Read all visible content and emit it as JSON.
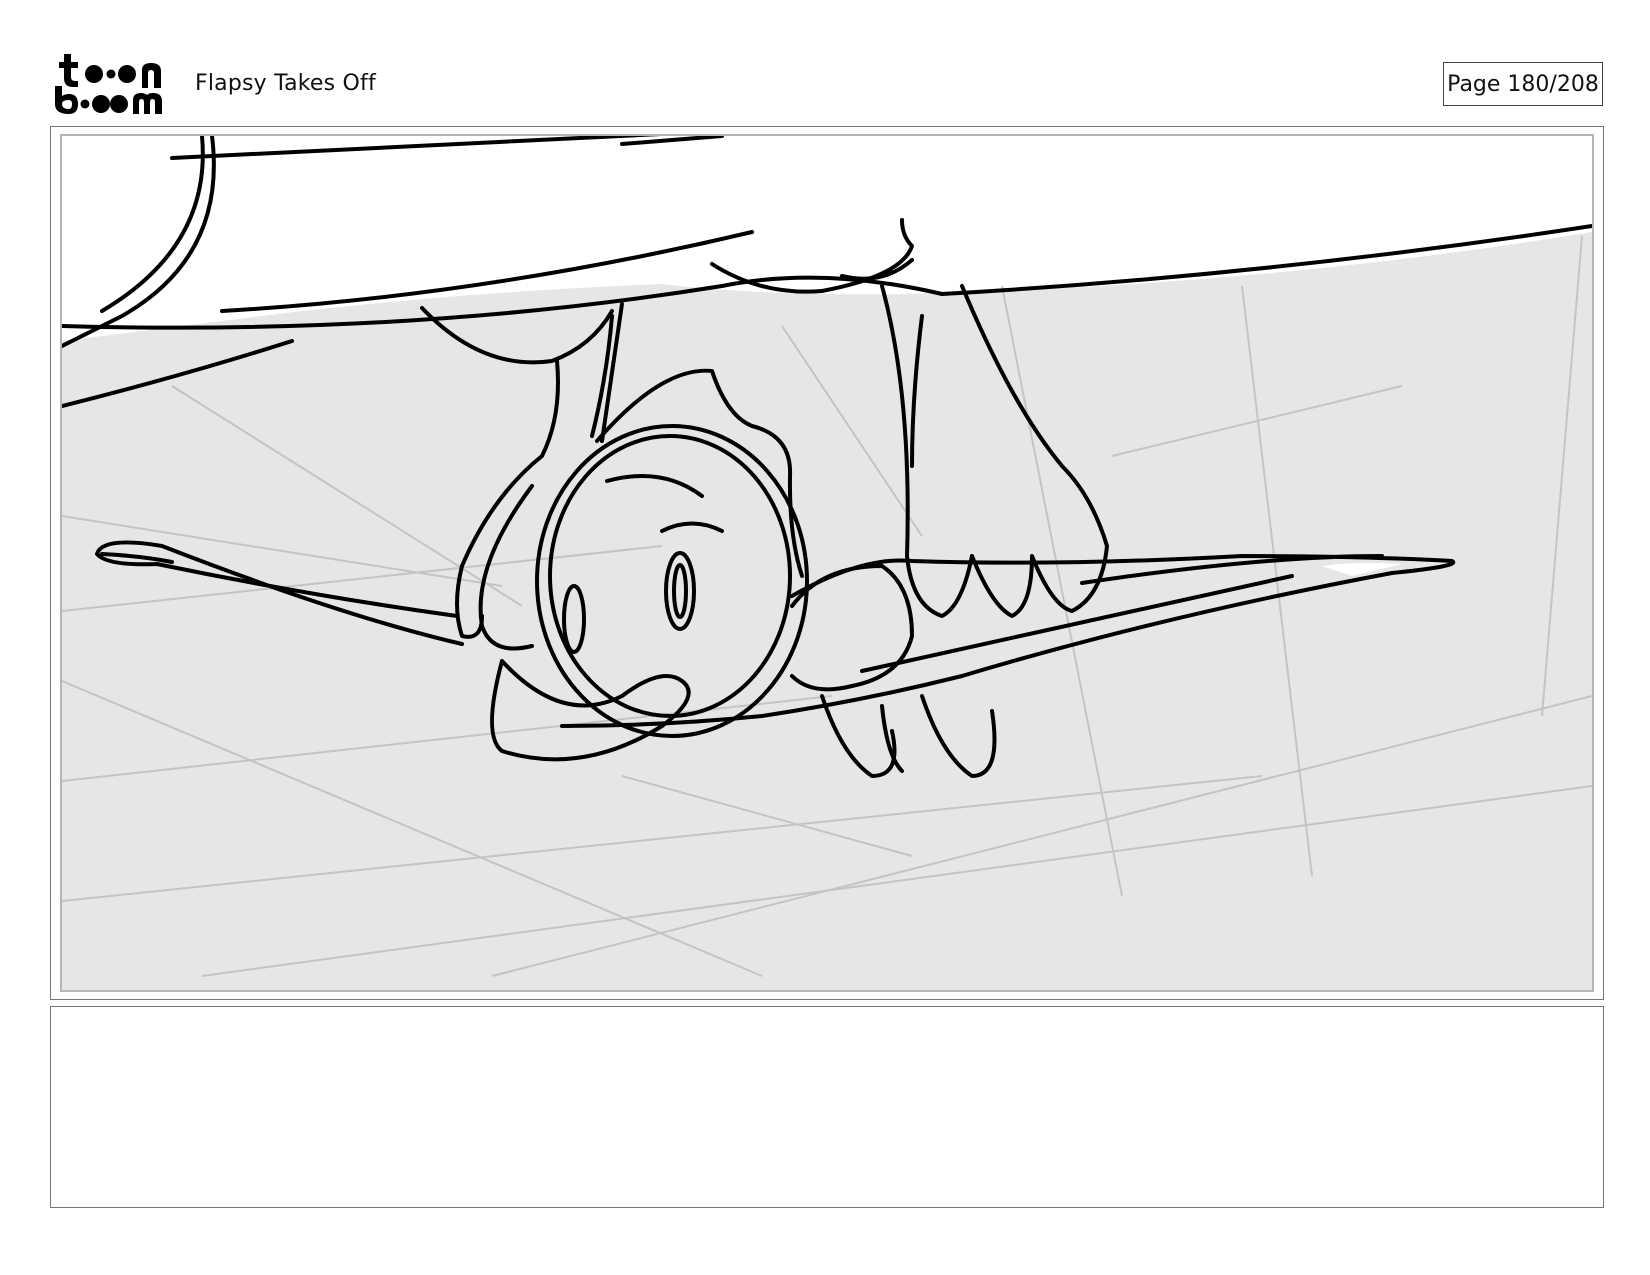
{
  "header": {
    "logo_text": "toon boom",
    "project_title": "Flapsy Takes Off",
    "page_label": "Page 180/208"
  },
  "panel": {
    "background_color": "#e6e6e6",
    "sketch_line_color": "#000000",
    "guide_line_color": "#c4c4c4"
  },
  "notes": {
    "text": ""
  }
}
